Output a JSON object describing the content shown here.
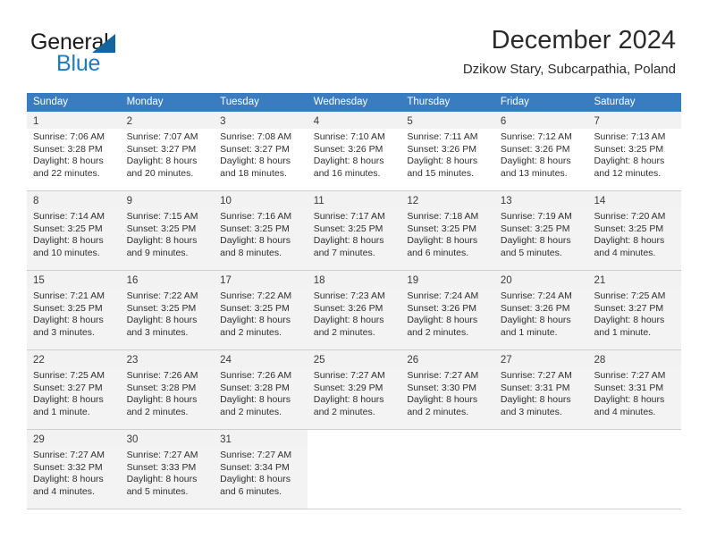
{
  "brand": {
    "name_part1": "General",
    "name_part2": "Blue",
    "logo_icon": "blue-triangle-icon",
    "accent_color": "#1f7ac0"
  },
  "header": {
    "title": "December 2024",
    "subtitle": "Dzikow Stary, Subcarpathia, Poland"
  },
  "calendar": {
    "header_bg_color": "#3a7cc0",
    "weekdays": [
      "Sunday",
      "Monday",
      "Tuesday",
      "Wednesday",
      "Thursday",
      "Friday",
      "Saturday"
    ],
    "weeks": [
      [
        {
          "day": "1",
          "sunrise": "Sunrise: 7:06 AM",
          "sunset": "Sunset: 3:28 PM",
          "daylight_line1": "Daylight: 8 hours",
          "daylight_line2": "and 22 minutes."
        },
        {
          "day": "2",
          "sunrise": "Sunrise: 7:07 AM",
          "sunset": "Sunset: 3:27 PM",
          "daylight_line1": "Daylight: 8 hours",
          "daylight_line2": "and 20 minutes."
        },
        {
          "day": "3",
          "sunrise": "Sunrise: 7:08 AM",
          "sunset": "Sunset: 3:27 PM",
          "daylight_line1": "Daylight: 8 hours",
          "daylight_line2": "and 18 minutes."
        },
        {
          "day": "4",
          "sunrise": "Sunrise: 7:10 AM",
          "sunset": "Sunset: 3:26 PM",
          "daylight_line1": "Daylight: 8 hours",
          "daylight_line2": "and 16 minutes."
        },
        {
          "day": "5",
          "sunrise": "Sunrise: 7:11 AM",
          "sunset": "Sunset: 3:26 PM",
          "daylight_line1": "Daylight: 8 hours",
          "daylight_line2": "and 15 minutes."
        },
        {
          "day": "6",
          "sunrise": "Sunrise: 7:12 AM",
          "sunset": "Sunset: 3:26 PM",
          "daylight_line1": "Daylight: 8 hours",
          "daylight_line2": "and 13 minutes."
        },
        {
          "day": "7",
          "sunrise": "Sunrise: 7:13 AM",
          "sunset": "Sunset: 3:25 PM",
          "daylight_line1": "Daylight: 8 hours",
          "daylight_line2": "and 12 minutes."
        }
      ],
      [
        {
          "day": "8",
          "sunrise": "Sunrise: 7:14 AM",
          "sunset": "Sunset: 3:25 PM",
          "daylight_line1": "Daylight: 8 hours",
          "daylight_line2": "and 10 minutes."
        },
        {
          "day": "9",
          "sunrise": "Sunrise: 7:15 AM",
          "sunset": "Sunset: 3:25 PM",
          "daylight_line1": "Daylight: 8 hours",
          "daylight_line2": "and 9 minutes."
        },
        {
          "day": "10",
          "sunrise": "Sunrise: 7:16 AM",
          "sunset": "Sunset: 3:25 PM",
          "daylight_line1": "Daylight: 8 hours",
          "daylight_line2": "and 8 minutes."
        },
        {
          "day": "11",
          "sunrise": "Sunrise: 7:17 AM",
          "sunset": "Sunset: 3:25 PM",
          "daylight_line1": "Daylight: 8 hours",
          "daylight_line2": "and 7 minutes."
        },
        {
          "day": "12",
          "sunrise": "Sunrise: 7:18 AM",
          "sunset": "Sunset: 3:25 PM",
          "daylight_line1": "Daylight: 8 hours",
          "daylight_line2": "and 6 minutes."
        },
        {
          "day": "13",
          "sunrise": "Sunrise: 7:19 AM",
          "sunset": "Sunset: 3:25 PM",
          "daylight_line1": "Daylight: 8 hours",
          "daylight_line2": "and 5 minutes."
        },
        {
          "day": "14",
          "sunrise": "Sunrise: 7:20 AM",
          "sunset": "Sunset: 3:25 PM",
          "daylight_line1": "Daylight: 8 hours",
          "daylight_line2": "and 4 minutes."
        }
      ],
      [
        {
          "day": "15",
          "sunrise": "Sunrise: 7:21 AM",
          "sunset": "Sunset: 3:25 PM",
          "daylight_line1": "Daylight: 8 hours",
          "daylight_line2": "and 3 minutes."
        },
        {
          "day": "16",
          "sunrise": "Sunrise: 7:22 AM",
          "sunset": "Sunset: 3:25 PM",
          "daylight_line1": "Daylight: 8 hours",
          "daylight_line2": "and 3 minutes."
        },
        {
          "day": "17",
          "sunrise": "Sunrise: 7:22 AM",
          "sunset": "Sunset: 3:25 PM",
          "daylight_line1": "Daylight: 8 hours",
          "daylight_line2": "and 2 minutes."
        },
        {
          "day": "18",
          "sunrise": "Sunrise: 7:23 AM",
          "sunset": "Sunset: 3:26 PM",
          "daylight_line1": "Daylight: 8 hours",
          "daylight_line2": "and 2 minutes."
        },
        {
          "day": "19",
          "sunrise": "Sunrise: 7:24 AM",
          "sunset": "Sunset: 3:26 PM",
          "daylight_line1": "Daylight: 8 hours",
          "daylight_line2": "and 2 minutes."
        },
        {
          "day": "20",
          "sunrise": "Sunrise: 7:24 AM",
          "sunset": "Sunset: 3:26 PM",
          "daylight_line1": "Daylight: 8 hours",
          "daylight_line2": "and 1 minute."
        },
        {
          "day": "21",
          "sunrise": "Sunrise: 7:25 AM",
          "sunset": "Sunset: 3:27 PM",
          "daylight_line1": "Daylight: 8 hours",
          "daylight_line2": "and 1 minute."
        }
      ],
      [
        {
          "day": "22",
          "sunrise": "Sunrise: 7:25 AM",
          "sunset": "Sunset: 3:27 PM",
          "daylight_line1": "Daylight: 8 hours",
          "daylight_line2": "and 1 minute."
        },
        {
          "day": "23",
          "sunrise": "Sunrise: 7:26 AM",
          "sunset": "Sunset: 3:28 PM",
          "daylight_line1": "Daylight: 8 hours",
          "daylight_line2": "and 2 minutes."
        },
        {
          "day": "24",
          "sunrise": "Sunrise: 7:26 AM",
          "sunset": "Sunset: 3:28 PM",
          "daylight_line1": "Daylight: 8 hours",
          "daylight_line2": "and 2 minutes."
        },
        {
          "day": "25",
          "sunrise": "Sunrise: 7:27 AM",
          "sunset": "Sunset: 3:29 PM",
          "daylight_line1": "Daylight: 8 hours",
          "daylight_line2": "and 2 minutes."
        },
        {
          "day": "26",
          "sunrise": "Sunrise: 7:27 AM",
          "sunset": "Sunset: 3:30 PM",
          "daylight_line1": "Daylight: 8 hours",
          "daylight_line2": "and 2 minutes."
        },
        {
          "day": "27",
          "sunrise": "Sunrise: 7:27 AM",
          "sunset": "Sunset: 3:31 PM",
          "daylight_line1": "Daylight: 8 hours",
          "daylight_line2": "and 3 minutes."
        },
        {
          "day": "28",
          "sunrise": "Sunrise: 7:27 AM",
          "sunset": "Sunset: 3:31 PM",
          "daylight_line1": "Daylight: 8 hours",
          "daylight_line2": "and 4 minutes."
        }
      ],
      [
        {
          "day": "29",
          "sunrise": "Sunrise: 7:27 AM",
          "sunset": "Sunset: 3:32 PM",
          "daylight_line1": "Daylight: 8 hours",
          "daylight_line2": "and 4 minutes."
        },
        {
          "day": "30",
          "sunrise": "Sunrise: 7:27 AM",
          "sunset": "Sunset: 3:33 PM",
          "daylight_line1": "Daylight: 8 hours",
          "daylight_line2": "and 5 minutes."
        },
        {
          "day": "31",
          "sunrise": "Sunrise: 7:27 AM",
          "sunset": "Sunset: 3:34 PM",
          "daylight_line1": "Daylight: 8 hours",
          "daylight_line2": "and 6 minutes."
        },
        {
          "day": "",
          "sunrise": "",
          "sunset": "",
          "daylight_line1": "",
          "daylight_line2": ""
        },
        {
          "day": "",
          "sunrise": "",
          "sunset": "",
          "daylight_line1": "",
          "daylight_line2": ""
        },
        {
          "day": "",
          "sunrise": "",
          "sunset": "",
          "daylight_line1": "",
          "daylight_line2": ""
        },
        {
          "day": "",
          "sunrise": "",
          "sunset": "",
          "daylight_line1": "",
          "daylight_line2": ""
        }
      ]
    ]
  }
}
